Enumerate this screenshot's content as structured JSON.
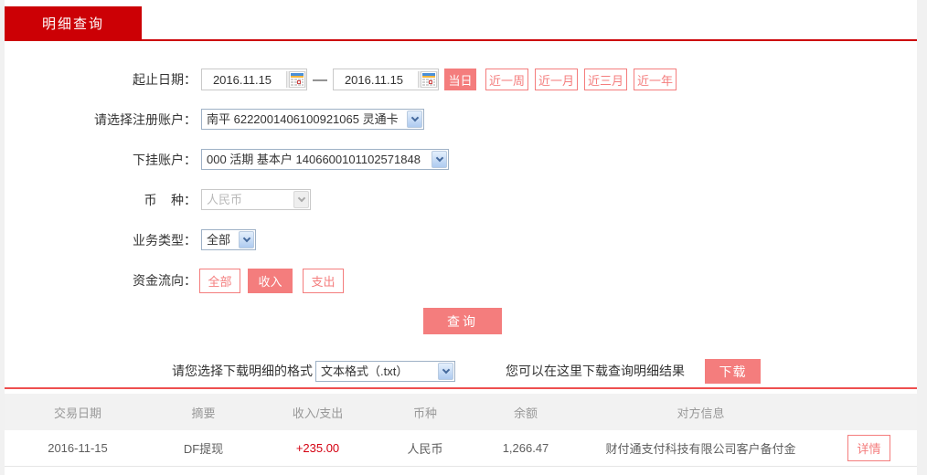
{
  "tab": {
    "label": "明细查询"
  },
  "form": {
    "date_range": {
      "label": "起止日期：",
      "start_value": "2016.11.15",
      "end_value": "2016.11.15",
      "separator": "—",
      "quick_buttons": [
        {
          "label": "当日",
          "active": true
        },
        {
          "label": "近一周",
          "active": false
        },
        {
          "label": "近一月",
          "active": false
        },
        {
          "label": "近三月",
          "active": false
        },
        {
          "label": "近一年",
          "active": false
        }
      ]
    },
    "register_account": {
      "label": "请选择注册账户：",
      "value": "南平 6222001406100921065 灵通卡"
    },
    "sub_account": {
      "label": "下挂账户：",
      "value": "000 活期 基本户 1406600101102571848"
    },
    "currency": {
      "label": "币    种：",
      "value": "人民币",
      "disabled": true
    },
    "business_type": {
      "label": "业务类型：",
      "value": "全部"
    },
    "fund_flow": {
      "label": "资金流向：",
      "buttons": [
        {
          "label": "全部",
          "active": false
        },
        {
          "label": "收入",
          "active": true
        },
        {
          "label": "支出",
          "active": false
        }
      ]
    },
    "query_button": "查询"
  },
  "download": {
    "format_label": "请您选择下载明细的格式",
    "format_value": "文本格式（.txt）",
    "hint": "您可以在这里下载查询明细结果",
    "button": "下载"
  },
  "table": {
    "headers": [
      "交易日期",
      "摘要",
      "收入/支出",
      "币种",
      "余额",
      "对方信息"
    ],
    "rows": [
      {
        "date": "2016-11-15",
        "summary": "DF提现",
        "amount": "+235.00",
        "currency": "人民币",
        "balance": "1,266.47",
        "counterparty": "财付通支付科技有限公司客户备付金",
        "detail_button": "详情"
      }
    ]
  },
  "colors": {
    "brand_red": "#cc0005",
    "accent_pink": "#f47d7d",
    "separator_red": "#ee4f4f",
    "amount_red": "#d40011",
    "header_text": "#999999",
    "page_bg": "#f1f1f1"
  }
}
